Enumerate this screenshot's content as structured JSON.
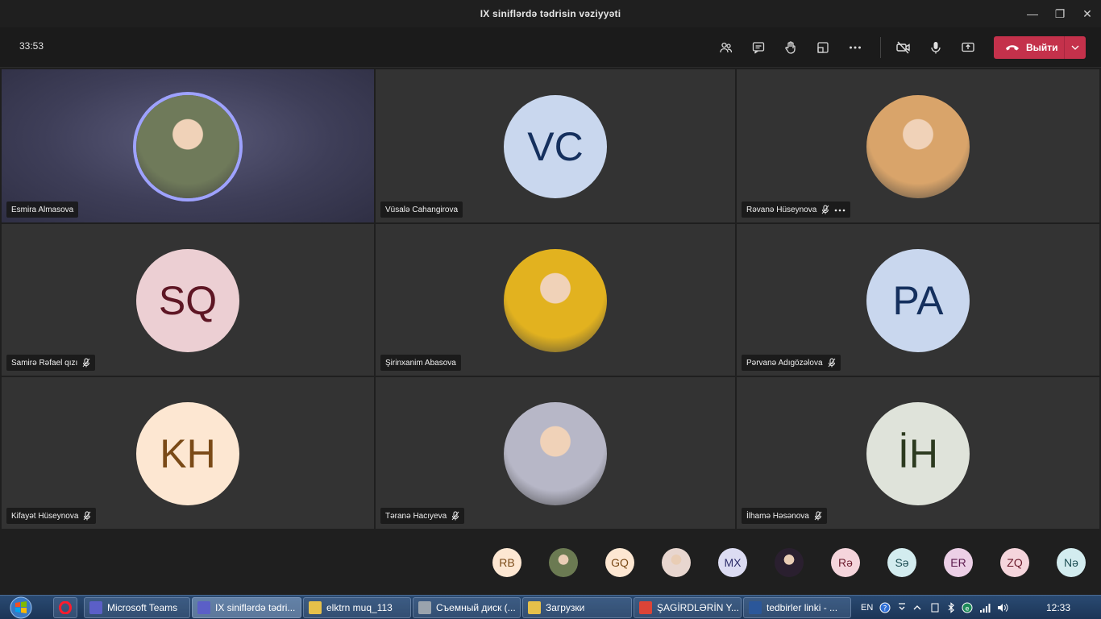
{
  "window": {
    "title": "IX siniflərdə tədrisin vəziyyəti",
    "minimize_label": "—",
    "restore_label": "❐",
    "close_label": "✕"
  },
  "toolbar": {
    "timer": "33:53",
    "leave_label": "Выйти"
  },
  "participants": [
    {
      "name": "Esmira Almasova",
      "initials": "",
      "photo": true,
      "muted": false,
      "more": false,
      "active": true,
      "bg": "#6f7a5a",
      "fg": "#ffffff"
    },
    {
      "name": "Vüsalə Cahangirova",
      "initials": "VC",
      "photo": false,
      "muted": false,
      "more": false,
      "active": false,
      "bg": "#c9d7ee",
      "fg": "#15305e"
    },
    {
      "name": "Rəvanə Hüseynova",
      "initials": "",
      "photo": true,
      "muted": true,
      "more": true,
      "active": false,
      "bg": "#d9a46a",
      "fg": "#ffffff"
    },
    {
      "name": "Samirə Rəfael qızı",
      "initials": "SQ",
      "photo": false,
      "muted": true,
      "more": false,
      "active": false,
      "bg": "#eccfd3",
      "fg": "#5e1624"
    },
    {
      "name": "Şirinxanim Abasova",
      "initials": "",
      "photo": true,
      "muted": false,
      "more": false,
      "active": false,
      "bg": "#e2b21f",
      "fg": "#ffffff"
    },
    {
      "name": "Pərvanə Adıgözəlova",
      "initials": "PA",
      "photo": false,
      "muted": true,
      "more": false,
      "active": false,
      "bg": "#c9d7ee",
      "fg": "#15305e"
    },
    {
      "name": "Kifayət Hüseynova",
      "initials": "KH",
      "photo": false,
      "muted": true,
      "more": false,
      "active": false,
      "bg": "#fde7d2",
      "fg": "#7a4a17"
    },
    {
      "name": "Təranə Hacıyeva",
      "initials": "",
      "photo": true,
      "muted": true,
      "more": false,
      "active": false,
      "bg": "#b7b7c7",
      "fg": "#ffffff"
    },
    {
      "name": "İlhamə Həsənova",
      "initials": "İH",
      "photo": false,
      "muted": true,
      "more": false,
      "active": false,
      "bg": "#dfe3da",
      "fg": "#2c3a1f"
    }
  ],
  "strip": [
    {
      "initials": "RB",
      "bg": "#fde7d2",
      "fg": "#7a4a17"
    },
    {
      "initials": "",
      "bg": "#6b7a52",
      "fg": "#ffffff"
    },
    {
      "initials": "GQ",
      "bg": "#fde7d2",
      "fg": "#7a4a17"
    },
    {
      "initials": "",
      "bg": "#e8d6cf",
      "fg": "#ffffff"
    },
    {
      "initials": "MX",
      "bg": "#dcdcf2",
      "fg": "#2d2d6a"
    },
    {
      "initials": "",
      "bg": "#2a1f2f",
      "fg": "#ffffff"
    },
    {
      "initials": "Rə",
      "bg": "#f5d5dc",
      "fg": "#6b1a2b"
    },
    {
      "initials": "Sə",
      "bg": "#d3ecef",
      "fg": "#1b4c52"
    },
    {
      "initials": "ER",
      "bg": "#eccfe6",
      "fg": "#5c1a4e"
    },
    {
      "initials": "ZQ",
      "bg": "#f5d5dc",
      "fg": "#6b1a2b"
    },
    {
      "initials": "Nə",
      "bg": "#d3ecef",
      "fg": "#1b4c52"
    }
  ],
  "taskbar": {
    "items": [
      {
        "label": "Microsoft Teams",
        "icon_color": "#5b5fc7",
        "active": false
      },
      {
        "label": "IX siniflərdə tədri...",
        "icon_color": "#5b5fc7",
        "active": true
      },
      {
        "label": "elktrn muq_113",
        "icon_color": "#e6c04a",
        "active": false
      },
      {
        "label": "Съемный диск (...",
        "icon_color": "#9aa3ad",
        "active": false
      },
      {
        "label": "Загрузки",
        "icon_color": "#e6c04a",
        "active": false
      },
      {
        "label": "ŞAGİRDLƏRİN Y...",
        "icon_color": "#db4437",
        "active": false
      },
      {
        "label": "tedbirler linki - ...",
        "icon_color": "#2b579a",
        "active": false
      }
    ],
    "lang": "EN",
    "clock": "12:33"
  }
}
